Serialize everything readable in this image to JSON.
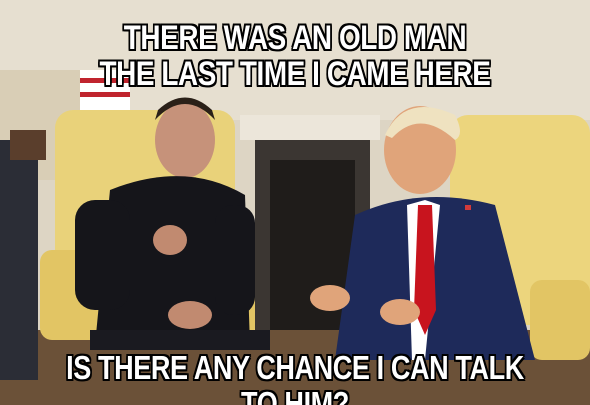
{
  "meme": {
    "top_text": [
      "THERE WAS AN OLD MAN",
      "THE LAST TIME I CAME HERE"
    ],
    "bottom_text": "IS THERE ANY CHANCE I CAN TALK TO HIM?"
  }
}
